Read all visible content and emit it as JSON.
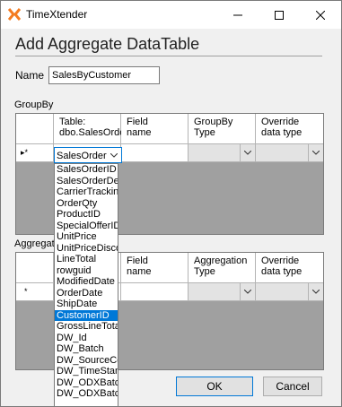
{
  "window": {
    "app_title": "TimeXtender",
    "brand_color": "#f47b20"
  },
  "dialog": {
    "title": "Add Aggregate DataTable",
    "name_label": "Name",
    "name_value": "SalesByCustomer"
  },
  "groupby": {
    "section_label": "GroupBy",
    "headers": [
      "Table:\ndbo.SalesOrde",
      "Field\nname",
      "GroupBy\nType",
      "Override\ndata type"
    ],
    "row_marker": "▸*",
    "selected_value": "SalesOrder"
  },
  "aggregate": {
    "section_label": "Aggregat",
    "headers": [
      "Field\nname",
      "Aggregation\nType",
      "Override\ndata type"
    ],
    "row_marker": "*"
  },
  "dropdown": {
    "items": [
      "SalesOrderID",
      "SalesOrderDeta",
      "CarrierTracking",
      "OrderQty",
      "ProductID",
      "SpecialOfferID",
      "UnitPrice",
      "UnitPriceDisco",
      "LineTotal",
      "rowguid",
      "ModifiedDate",
      "OrderDate",
      "ShipDate",
      "CustomerID",
      "GrossLineTotal",
      "DW_Id",
      "DW_Batch",
      "DW_SourceCo",
      "DW_TimeStam",
      "DW_ODXBatc",
      "DW_ODXBatch"
    ],
    "selected": "CustomerID"
  },
  "buttons": {
    "ok": "OK",
    "cancel": "Cancel"
  }
}
